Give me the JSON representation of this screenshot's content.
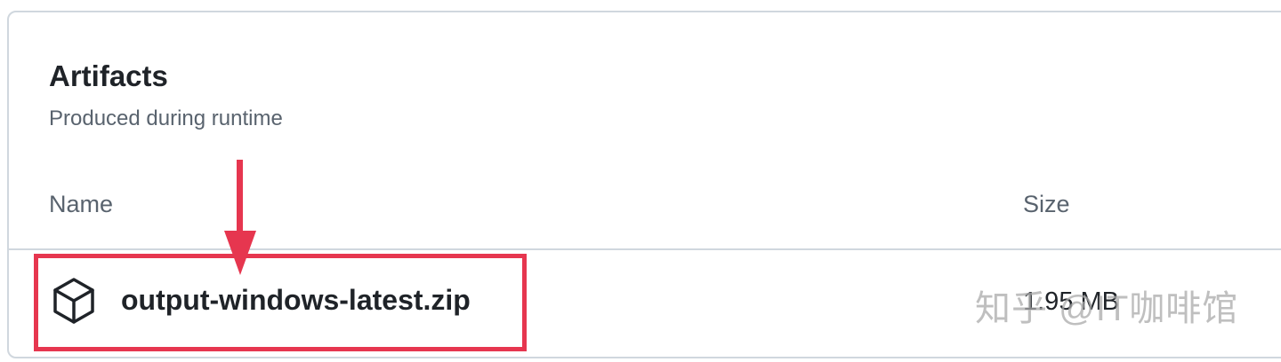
{
  "artifacts": {
    "title": "Artifacts",
    "subtitle": "Produced during runtime",
    "columns": {
      "name": "Name",
      "size": "Size"
    },
    "items": [
      {
        "name": "output-windows-latest.zip",
        "size": "1.95 MB",
        "icon": "package-icon"
      }
    ]
  },
  "annotation": {
    "color": "#e6364f"
  },
  "watermark": {
    "text": "知乎 @IT咖啡馆"
  }
}
